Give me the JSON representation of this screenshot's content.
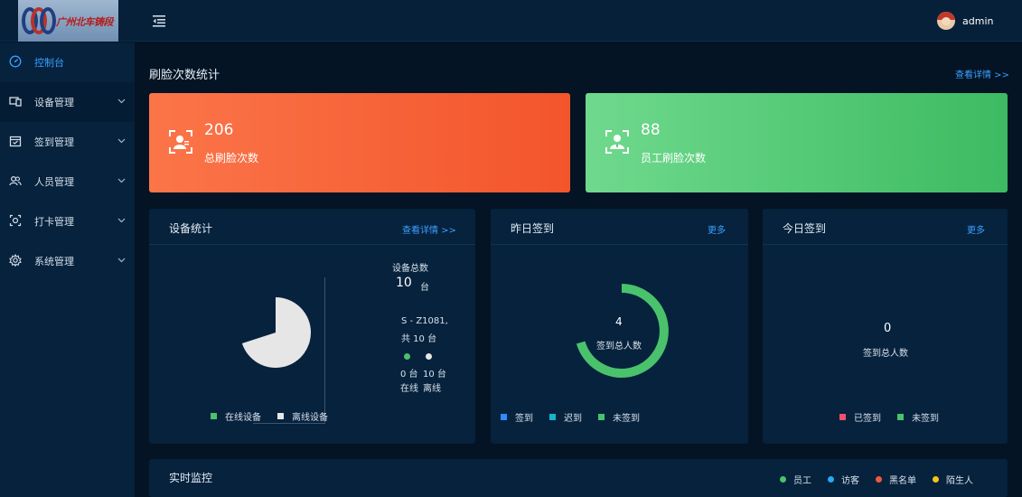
{
  "header": {
    "logo_text": "广州北车铸段",
    "username": "admin"
  },
  "sidebar": {
    "items": [
      {
        "label": "控制台",
        "icon": "dashboard-icon"
      },
      {
        "label": "设备管理",
        "icon": "device-icon"
      },
      {
        "label": "签到管理",
        "icon": "calendar-check-icon"
      },
      {
        "label": "人员管理",
        "icon": "users-icon"
      },
      {
        "label": "打卡管理",
        "icon": "camera-icon"
      },
      {
        "label": "系统管理",
        "icon": "gear-icon"
      }
    ]
  },
  "face_stats": {
    "title": "刷脸次数统计",
    "details_link": "查看详情 >>",
    "total": {
      "value": "206",
      "label": "总刷脸次数",
      "icon": "face-scan-icon"
    },
    "staff": {
      "value": "88",
      "label": "员工刷脸次数",
      "icon": "staff-scan-icon"
    }
  },
  "device_stats": {
    "title": "设备统计",
    "details_link": "查看详情 >>",
    "total_label": "设备总数",
    "total_value": "10",
    "total_unit": "台",
    "model_line1": "S - Z1081,",
    "model_line2": "共 10 台",
    "online_count": "0 台",
    "offline_count": "10 台",
    "online_word": "在线",
    "offline_word": "离线",
    "legend_online": "在线设备",
    "legend_offline": "离线设备",
    "colors": {
      "online": "#4ac26b",
      "offline": "#e6e6e6"
    }
  },
  "yesterday_checkin": {
    "title": "昨日签到",
    "more_link": "更多",
    "value": "4",
    "caption": "签到总人数",
    "legend": [
      {
        "label": "签到",
        "color": "#2f8cff"
      },
      {
        "label": "迟到",
        "color": "#16b5c6"
      },
      {
        "label": "未签到",
        "color": "#4ac26b"
      }
    ]
  },
  "today_checkin": {
    "title": "今日签到",
    "more_link": "更多",
    "value": "0",
    "caption": "签到总人数",
    "legend": [
      {
        "label": "已签到",
        "color": "#f0506e"
      },
      {
        "label": "未签到",
        "color": "#4ac26b"
      }
    ]
  },
  "realtime": {
    "title": "实时监控",
    "legend": [
      {
        "label": "员工",
        "color": "#4ac26b"
      },
      {
        "label": "访客",
        "color": "#2aa7f5"
      },
      {
        "label": "黑名单",
        "color": "#f05a3c"
      },
      {
        "label": "陌生人",
        "color": "#f5c518"
      }
    ]
  }
}
